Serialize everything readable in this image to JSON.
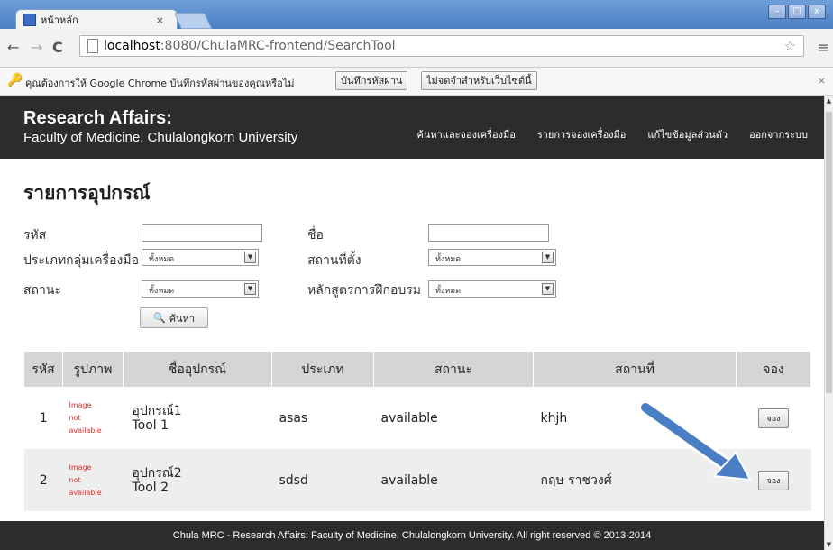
{
  "browser": {
    "tab_title": "หน้าหลัก",
    "tab_close": "×",
    "url_host": "localhost",
    "url_rest": ":8080/ChulaMRC-frontend/SearchTool",
    "infobar": {
      "message": "คุณต้องการให้ Google Chrome บันทึกรหัสผ่านของคุณหรือไม่",
      "save_label": "บันทึกรหัสผ่าน",
      "never_label": "ไม่จดจำสำหรับเว็บไซต์นี้",
      "close": "×"
    },
    "window_buttons": [
      "–",
      "□",
      "x"
    ]
  },
  "header": {
    "brand_line1": "Research Affairs:",
    "brand_line2": "Faculty of Medicine, Chulalongkorn University",
    "nav": [
      "ค้นหาและจองเครื่องมือ",
      "รายการจองเครื่องมือ",
      "แก้ไขข้อมูลส่วนตัว",
      "ออกจากระบบ"
    ]
  },
  "page": {
    "title": "รายการอุปกรณ์"
  },
  "filters": {
    "code_label": "รหัส",
    "code_value": "",
    "name_label": "ชื่อ",
    "name_value": "",
    "group_label": "ประเภทกลุ่มเครื่องมือ",
    "group_value": "ทั้งหมด",
    "location_label": "สถานที่ตั้ง",
    "location_value": "ทั้งหมด",
    "status_label": "สถานะ",
    "status_value": "ทั้งหมด",
    "course_label": "หลักสูตรการฝึกอบรม",
    "course_value": "ทั้งหมด",
    "search_label": "ค้นหา"
  },
  "table": {
    "headers": [
      "รหัส",
      "รูปภาพ",
      "ชื่ออุปกรณ์",
      "ประเภท",
      "สถานะ",
      "สถานที่",
      "จอง"
    ],
    "rows": [
      {
        "id": "1",
        "image": [
          "Image",
          "not",
          "available"
        ],
        "name1": "อุปกรณ์1",
        "name2": "Tool 1",
        "type": "asas",
        "status": "available",
        "location": "khjh",
        "book": "จอง"
      },
      {
        "id": "2",
        "image": [
          "Image",
          "not",
          "available"
        ],
        "name1": "อุปกรณ์2",
        "name2": "Tool 2",
        "type": "sdsd",
        "status": "available",
        "location": "กฤษ ราชวงศ์",
        "book": "จอง"
      }
    ]
  },
  "footer": {
    "text": "Chula MRC - Research Affairs: Faculty of Medicine, Chulalongkorn University. All right reserved © 2013-2014"
  },
  "colors": {
    "header_bg": "#2c2c2c",
    "table_header_bg": "#d5d5d5",
    "image_missing": "#e03030",
    "annotation_arrow": "#4a7ec4"
  }
}
